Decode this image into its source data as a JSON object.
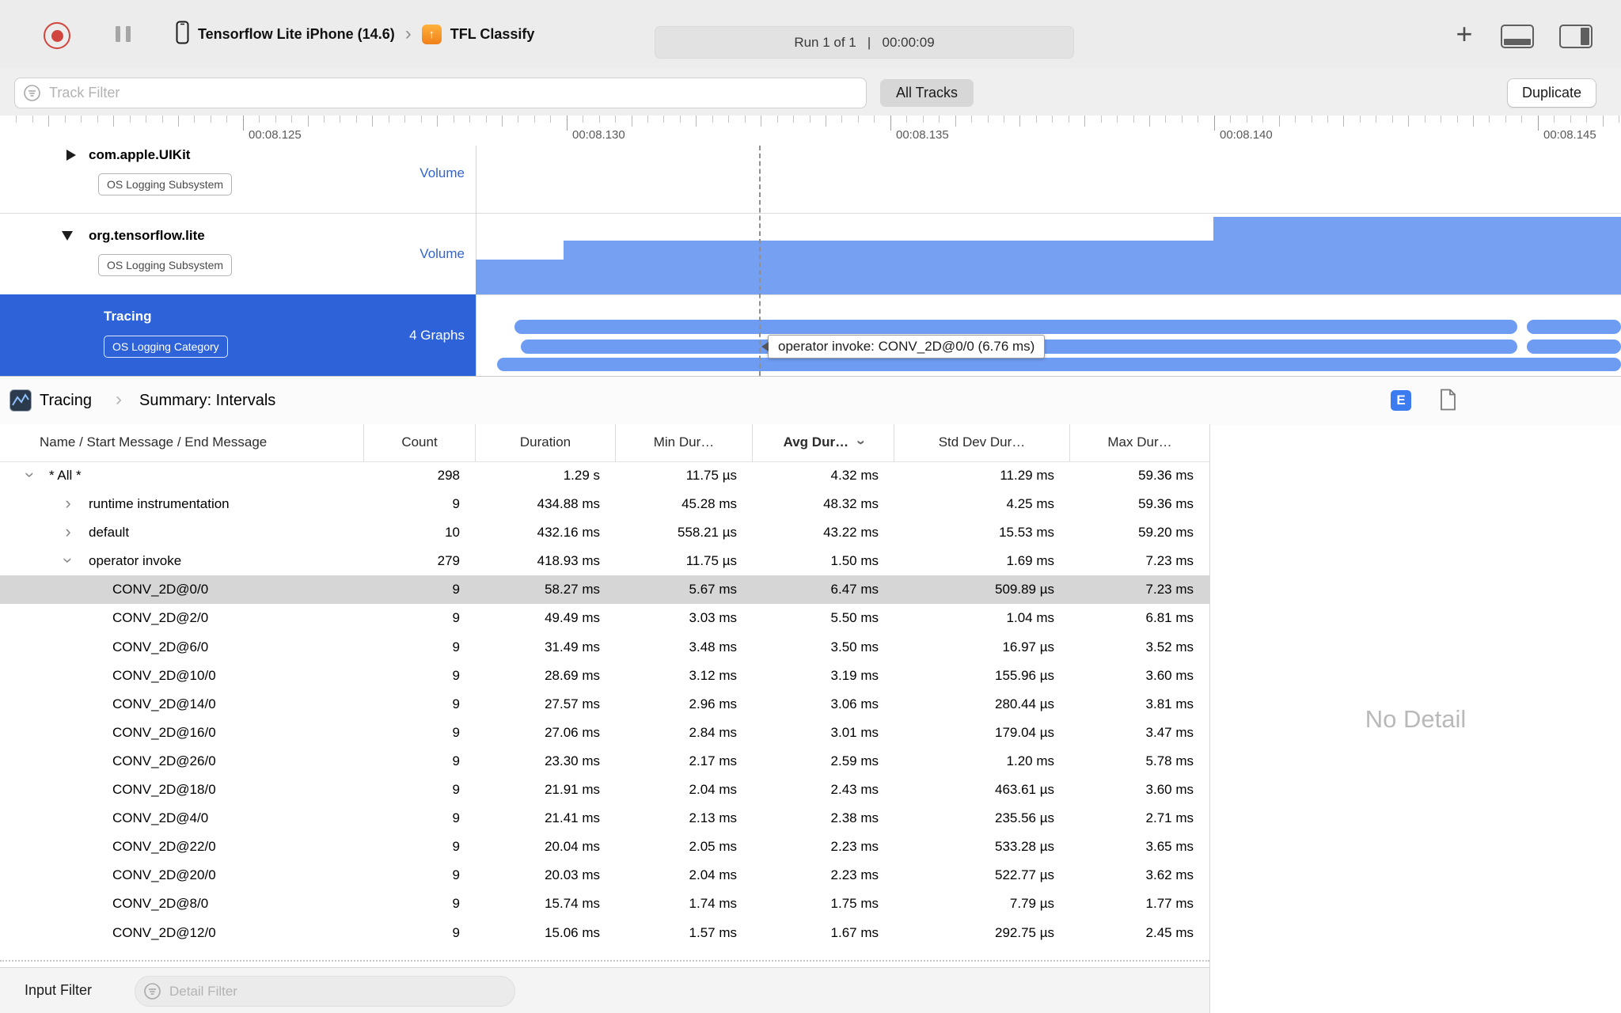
{
  "toolbar": {
    "device_name": "Tensorflow Lite iPhone (14.6)",
    "process_name": "TFL Classify",
    "run_status": "Run 1 of 1   |   00:00:09"
  },
  "filter_bar": {
    "track_filter_placeholder": "Track Filter",
    "all_tracks_label": "All Tracks",
    "duplicate_label": "Duplicate"
  },
  "ruler": {
    "labels": [
      "00:08.125",
      "00:08.130",
      "00:08.135",
      "00:08.140",
      "00:08.145"
    ]
  },
  "tracks": [
    {
      "name": "com.apple.UIKit",
      "badge": "OS Logging Subsystem",
      "meta": "Volume",
      "disclosure": "collapsed"
    },
    {
      "name": "org.tensorflow.lite",
      "badge": "OS Logging Subsystem",
      "meta": "Volume",
      "disclosure": "expanded"
    },
    {
      "name": "Tracing",
      "badge": "OS Logging Category",
      "meta": "4 Graphs",
      "selected": true
    }
  ],
  "tooltip_text": "operator invoke: CONV_2D@0/0 (6.76 ms)",
  "detail_header": {
    "instrument": "Tracing",
    "view": "Summary: Intervals",
    "e_badge": "E"
  },
  "table": {
    "columns": [
      {
        "label": "Name / Start Message / End Message"
      },
      {
        "label": "Count"
      },
      {
        "label": "Duration"
      },
      {
        "label": "Min Dur…"
      },
      {
        "label": "Avg Dur…",
        "sorted": true
      },
      {
        "label": "Std Dev Dur…"
      },
      {
        "label": "Max Dur…"
      }
    ],
    "rows": [
      {
        "indent": 0,
        "disclosure": "open",
        "name": "* All *",
        "count": "298",
        "duration": "1.29 s",
        "min": "11.75 µs",
        "avg": "4.32 ms",
        "std": "11.29 ms",
        "max": "59.36 ms"
      },
      {
        "indent": 1,
        "disclosure": "closed",
        "name": "runtime instrumentation",
        "count": "9",
        "duration": "434.88 ms",
        "min": "45.28 ms",
        "avg": "48.32 ms",
        "std": "4.25 ms",
        "max": "59.36 ms"
      },
      {
        "indent": 1,
        "disclosure": "closed",
        "name": "default",
        "count": "10",
        "duration": "432.16 ms",
        "min": "558.21 µs",
        "avg": "43.22 ms",
        "std": "15.53 ms",
        "max": "59.20 ms"
      },
      {
        "indent": 1,
        "disclosure": "open",
        "name": "operator invoke",
        "count": "279",
        "duration": "418.93 ms",
        "min": "11.75 µs",
        "avg": "1.50 ms",
        "std": "1.69 ms",
        "max": "7.23 ms"
      },
      {
        "indent": 2,
        "selected": true,
        "name": "CONV_2D@0/0",
        "count": "9",
        "duration": "58.27 ms",
        "min": "5.67 ms",
        "avg": "6.47 ms",
        "std": "509.89 µs",
        "max": "7.23 ms"
      },
      {
        "indent": 2,
        "name": "CONV_2D@2/0",
        "count": "9",
        "duration": "49.49 ms",
        "min": "3.03 ms",
        "avg": "5.50 ms",
        "std": "1.04 ms",
        "max": "6.81 ms"
      },
      {
        "indent": 2,
        "name": "CONV_2D@6/0",
        "count": "9",
        "duration": "31.49 ms",
        "min": "3.48 ms",
        "avg": "3.50 ms",
        "std": "16.97 µs",
        "max": "3.52 ms"
      },
      {
        "indent": 2,
        "name": "CONV_2D@10/0",
        "count": "9",
        "duration": "28.69 ms",
        "min": "3.12 ms",
        "avg": "3.19 ms",
        "std": "155.96 µs",
        "max": "3.60 ms"
      },
      {
        "indent": 2,
        "name": "CONV_2D@14/0",
        "count": "9",
        "duration": "27.57 ms",
        "min": "2.96 ms",
        "avg": "3.06 ms",
        "std": "280.44 µs",
        "max": "3.81 ms"
      },
      {
        "indent": 2,
        "name": "CONV_2D@16/0",
        "count": "9",
        "duration": "27.06 ms",
        "min": "2.84 ms",
        "avg": "3.01 ms",
        "std": "179.04 µs",
        "max": "3.47 ms"
      },
      {
        "indent": 2,
        "name": "CONV_2D@26/0",
        "count": "9",
        "duration": "23.30 ms",
        "min": "2.17 ms",
        "avg": "2.59 ms",
        "std": "1.20 ms",
        "max": "5.78 ms"
      },
      {
        "indent": 2,
        "name": "CONV_2D@18/0",
        "count": "9",
        "duration": "21.91 ms",
        "min": "2.04 ms",
        "avg": "2.43 ms",
        "std": "463.61 µs",
        "max": "3.60 ms"
      },
      {
        "indent": 2,
        "name": "CONV_2D@4/0",
        "count": "9",
        "duration": "21.41 ms",
        "min": "2.13 ms",
        "avg": "2.38 ms",
        "std": "235.56 µs",
        "max": "2.71 ms"
      },
      {
        "indent": 2,
        "name": "CONV_2D@22/0",
        "count": "9",
        "duration": "20.04 ms",
        "min": "2.05 ms",
        "avg": "2.23 ms",
        "std": "533.28 µs",
        "max": "3.65 ms"
      },
      {
        "indent": 2,
        "name": "CONV_2D@20/0",
        "count": "9",
        "duration": "20.03 ms",
        "min": "2.04 ms",
        "avg": "2.23 ms",
        "std": "522.77 µs",
        "max": "3.62 ms"
      },
      {
        "indent": 2,
        "name": "CONV_2D@8/0",
        "count": "9",
        "duration": "15.74 ms",
        "min": "1.74 ms",
        "avg": "1.75 ms",
        "std": "7.79 µs",
        "max": "1.77 ms"
      },
      {
        "indent": 2,
        "name": "CONV_2D@12/0",
        "count": "9",
        "duration": "15.06 ms",
        "min": "1.57 ms",
        "avg": "1.67 ms",
        "std": "292.75 µs",
        "max": "2.45 ms"
      }
    ]
  },
  "no_detail_text": "No Detail",
  "bottom_bar": {
    "input_filter_label": "Input Filter",
    "detail_filter_placeholder": "Detail Filter"
  },
  "icons": {
    "chevron": "›",
    "plus": "+"
  },
  "colors": {
    "selection_blue": "#2d62d9",
    "bar_blue": "#6f9cf3",
    "accent_blue": "#3d7bf0",
    "record_red": "#d0453e"
  }
}
